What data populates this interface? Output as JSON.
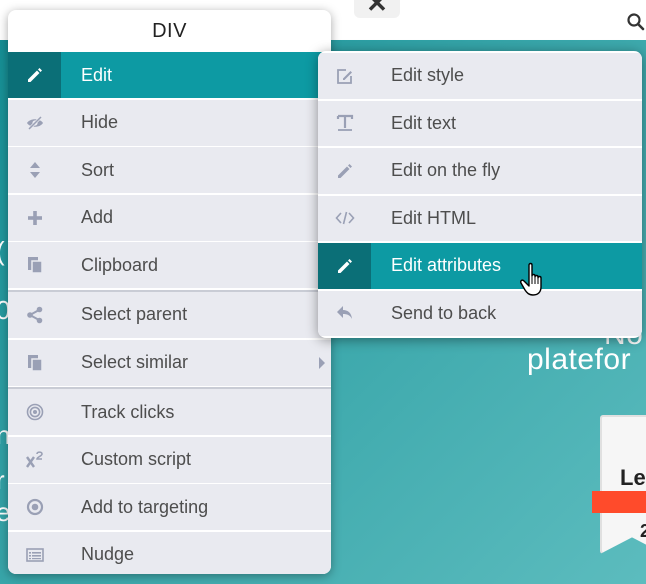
{
  "colors": {
    "accent": "#0d9aa3",
    "accent_dark": "#0b6f77",
    "row_bg": "#e9eaf0",
    "icon_gray": "#9aa0b5",
    "text": "#4d4d4d",
    "hero_bg": "#2b9ea3"
  },
  "background": {
    "close_glyph": "✕",
    "hero_text_line1": "No",
    "hero_text_line2": "platefor",
    "left_edge_chars": [
      "(",
      "0",
      "n",
      "r",
      "e"
    ],
    "badge_title": "Le",
    "badge_number": "2"
  },
  "menu": {
    "title": "DIV",
    "items": [
      {
        "label": "Edit",
        "icon": "pencil-icon",
        "active": true,
        "has_submenu": true
      },
      {
        "label": "Hide",
        "icon": "eye-slash-icon"
      },
      {
        "label": "Sort",
        "icon": "sort-arrows-icon"
      },
      {
        "label": "Add",
        "icon": "plus-icon"
      },
      {
        "label": "Clipboard",
        "icon": "clipboard-icon"
      },
      {
        "label": "Select parent",
        "icon": "share-nodes-icon"
      },
      {
        "label": "Select similar",
        "icon": "copy-icon",
        "has_submenu": true
      },
      {
        "label": "Track clicks",
        "icon": "target-icon"
      },
      {
        "label": "Custom script",
        "icon": "superscript-icon"
      },
      {
        "label": "Add to targeting",
        "icon": "dot-circle-icon"
      },
      {
        "label": "Nudge",
        "icon": "list-box-icon"
      }
    ]
  },
  "submenu": {
    "items": [
      {
        "label": "Edit style",
        "icon": "edit-square-icon"
      },
      {
        "label": "Edit text",
        "icon": "text-type-icon"
      },
      {
        "label": "Edit on the fly",
        "icon": "pencil-icon"
      },
      {
        "label": "Edit HTML",
        "icon": "code-icon"
      },
      {
        "label": "Edit attributes",
        "icon": "pencil-icon",
        "active": true
      },
      {
        "label": "Send to back",
        "icon": "reply-icon"
      }
    ]
  }
}
